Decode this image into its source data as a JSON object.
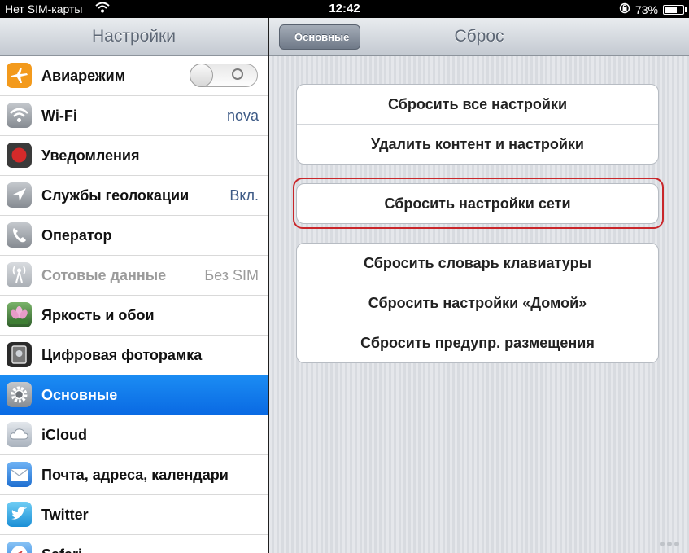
{
  "status_bar": {
    "carrier": "Нет SIM-карты",
    "time": "12:42",
    "battery_percent": "73%",
    "battery_level": 0.73
  },
  "master": {
    "title": "Настройки",
    "items": [
      {
        "label": "Авиарежим",
        "value": "",
        "icon": "airplane-icon",
        "icon_color": "#f39a1c"
      },
      {
        "label": "Wi-Fi",
        "value": "nova",
        "icon": "wifi-icon",
        "icon_color": "#8a8f96"
      },
      {
        "label": "Уведомления",
        "value": "",
        "icon": "notifications-icon",
        "icon_color": "#d42a2a"
      },
      {
        "label": "Службы геолокации",
        "value": "Вкл.",
        "icon": "location-icon",
        "icon_color": "#8a8f96"
      },
      {
        "label": "Оператор",
        "value": "",
        "icon": "phone-icon",
        "icon_color": "#8a8f96"
      },
      {
        "label": "Сотовые данные",
        "value": "Без SIM",
        "icon": "cellular-icon",
        "icon_color": "#9aa0a6"
      },
      {
        "label": "Яркость и обои",
        "value": "",
        "icon": "brightness-icon",
        "icon_color": "#4a8f3a"
      },
      {
        "label": "Цифровая фоторамка",
        "value": "",
        "icon": "photo-frame-icon",
        "icon_color": "#3a3a3a"
      },
      {
        "label": "Основные",
        "value": "",
        "icon": "gear-icon",
        "icon_color": "#8a8f96"
      },
      {
        "label": "iCloud",
        "value": "",
        "icon": "cloud-icon",
        "icon_color": "#b9c1cb"
      },
      {
        "label": "Почта, адреса, календари",
        "value": "",
        "icon": "mail-icon",
        "icon_color": "#2d7ed8"
      },
      {
        "label": "Twitter",
        "value": "",
        "icon": "twitter-icon",
        "icon_color": "#27a1e6"
      },
      {
        "label": "Safari",
        "value": "",
        "icon": "safari-icon",
        "icon_color": "#3c8fe3"
      }
    ]
  },
  "detail": {
    "back_label": "Основные",
    "title": "Сброс",
    "group1": [
      "Сбросить все настройки",
      "Удалить контент и настройки"
    ],
    "group2": [
      "Сбросить настройки сети"
    ],
    "group3": [
      "Сбросить словарь клавиатуры",
      "Сбросить настройки «Домой»",
      "Сбросить предупр. размещения"
    ]
  },
  "colors": {
    "selected_row": "#0a6ae3",
    "highlight_border": "#c9272b",
    "value_text": "#3d5a86"
  }
}
